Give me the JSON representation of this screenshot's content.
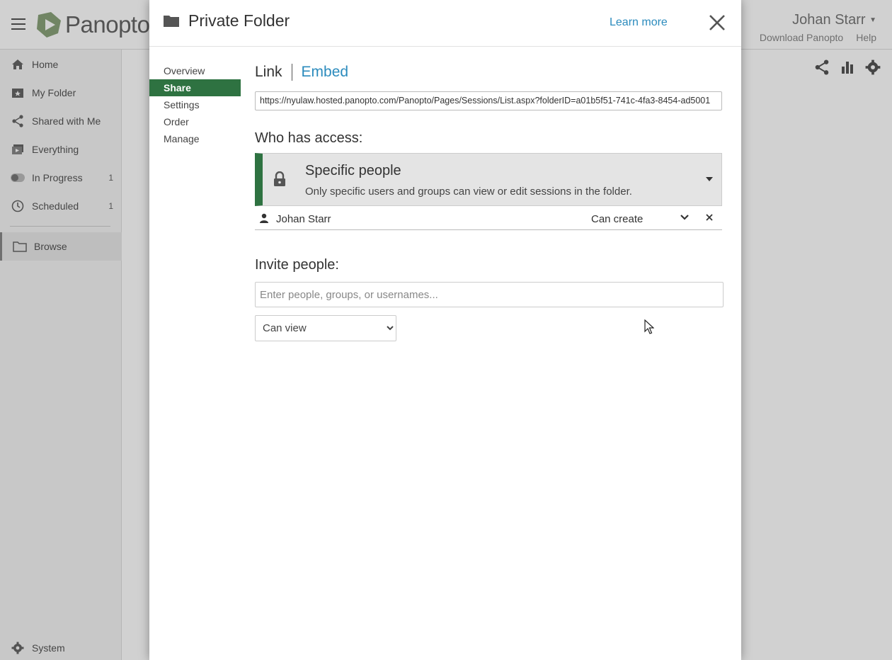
{
  "app": {
    "brand": "Panopto",
    "user_name": "Johan Starr",
    "top_links": [
      "Download Panopto",
      "Help"
    ]
  },
  "sidebar": {
    "items": [
      {
        "label": "Home",
        "icon": "home-icon"
      },
      {
        "label": "My Folder",
        "icon": "my-folder-icon"
      },
      {
        "label": "Shared with Me",
        "icon": "share-icon"
      },
      {
        "label": "Everything",
        "icon": "everything-icon"
      },
      {
        "label": "In Progress",
        "icon": "in-progress-icon",
        "count": "1"
      },
      {
        "label": "Scheduled",
        "icon": "clock-icon",
        "count": "1"
      },
      {
        "label": "Browse",
        "icon": "folder-icon"
      }
    ],
    "system_label": "System"
  },
  "modal": {
    "title": "Private Folder",
    "learn_more": "Learn more",
    "nav": [
      "Overview",
      "Share",
      "Settings",
      "Order",
      "Manage"
    ],
    "active_nav": "Share",
    "tabs": {
      "link": "Link",
      "embed": "Embed"
    },
    "url": "https://nyulaw.hosted.panopto.com/Panopto/Pages/Sessions/List.aspx?folderID=a01b5f51-741c-4fa3-8454-ad5001",
    "who_has_access_label": "Who has access:",
    "access": {
      "title": "Specific people",
      "description": "Only specific users and groups can view or edit sessions in the folder."
    },
    "people": [
      {
        "name": "Johan Starr",
        "role": "Can create"
      }
    ],
    "invite_label": "Invite people:",
    "invite_placeholder": "Enter people, groups, or usernames...",
    "permission_selected": "Can view",
    "accent_color": "#2e7241",
    "link_color": "#2b8bbd"
  }
}
